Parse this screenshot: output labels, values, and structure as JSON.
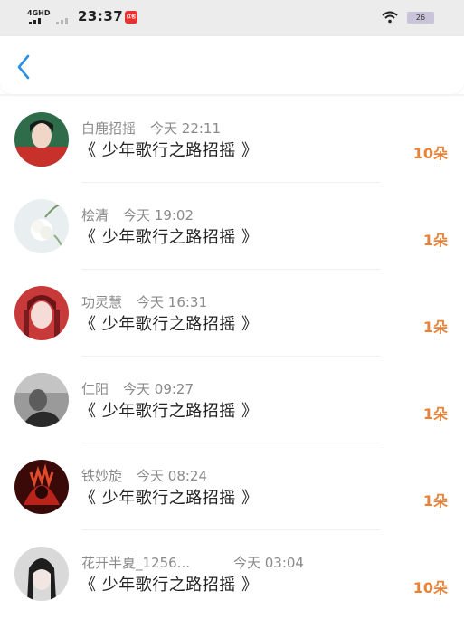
{
  "status_bar": {
    "network": "4GHD",
    "time": "23:37",
    "app_badge": "红包",
    "battery": "26"
  },
  "nav": {
    "back_icon": "chevron-left-icon"
  },
  "colors": {
    "accent": "#2b8fe6",
    "amount": "#e8823a",
    "meta": "#8a8a8a"
  },
  "records": [
    {
      "name": "白鹿招摇",
      "time": "今天 22:11",
      "title": "《 少年歌行之路招摇 》",
      "amount": "10朵"
    },
    {
      "name": "桧清",
      "time": "今天 19:02",
      "title": "《 少年歌行之路招摇 》",
      "amount": "1朵"
    },
    {
      "name": "功灵慧",
      "time": "今天 16:31",
      "title": "《 少年歌行之路招摇 》",
      "amount": "1朵"
    },
    {
      "name": "仁阳",
      "time": "今天 09:27",
      "title": "《 少年歌行之路招摇 》",
      "amount": "1朵"
    },
    {
      "name": "铁妙旋",
      "time": "今天 08:24",
      "title": "《 少年歌行之路招摇 》",
      "amount": "1朵"
    },
    {
      "name": "花开半夏_1256...",
      "time": "今天 03:04",
      "title": "《 少年歌行之路招摇 》",
      "amount": "10朵"
    }
  ]
}
